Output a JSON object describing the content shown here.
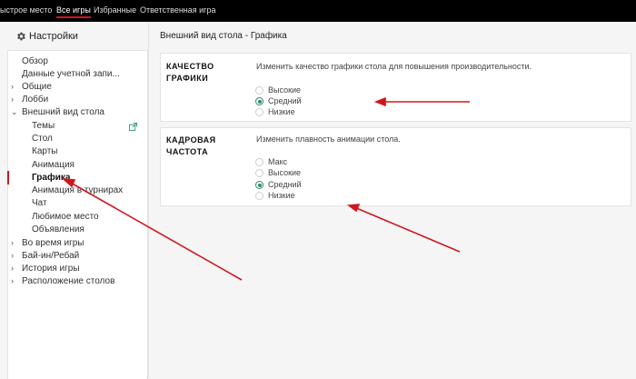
{
  "topbar": {
    "quick_seat": "ыстрое место",
    "all_games": "Все игры",
    "favorites": "Избранные",
    "responsible_game": "Ответственная игра"
  },
  "sidebar": {
    "title": "Настройки",
    "items": [
      {
        "label": "Обзор"
      },
      {
        "label": "Данные учетной запи..."
      },
      {
        "label": "Общие"
      },
      {
        "label": "Лобби"
      },
      {
        "label": "Внешний вид стола"
      },
      {
        "label": "Темы"
      },
      {
        "label": "Стол"
      },
      {
        "label": "Карты"
      },
      {
        "label": "Анимация"
      },
      {
        "label": "Графика"
      },
      {
        "label": "Анимация в турнирах"
      },
      {
        "label": "Чат"
      },
      {
        "label": "Любимое место"
      },
      {
        "label": "Объявления"
      },
      {
        "label": "Во время игры"
      },
      {
        "label": "Бай-ин/Ребай"
      },
      {
        "label": "История игры"
      },
      {
        "label": "Расположение столов"
      }
    ]
  },
  "main": {
    "title": "Внешний вид стола - Графика",
    "graphics_quality": {
      "title_line1": "КАЧЕСТВО",
      "title_line2": "ГРАФИКИ",
      "description": "Изменить качество графики стола для повышения производительности.",
      "options": [
        "Высокие",
        "Средний",
        "Низкие"
      ],
      "selected": "Средний"
    },
    "frame_rate": {
      "title_line1": "КАДРОВАЯ",
      "title_line2": "ЧАСТОТА",
      "description": "Изменить плавность анимации стола.",
      "options": [
        "Макс",
        "Высокие",
        "Средний",
        "Низкие"
      ],
      "selected": "Средний"
    }
  },
  "colors": {
    "accent_red": "#c8161e",
    "radio_green": "#2e8b6a",
    "topbar_bg": "#000000"
  }
}
